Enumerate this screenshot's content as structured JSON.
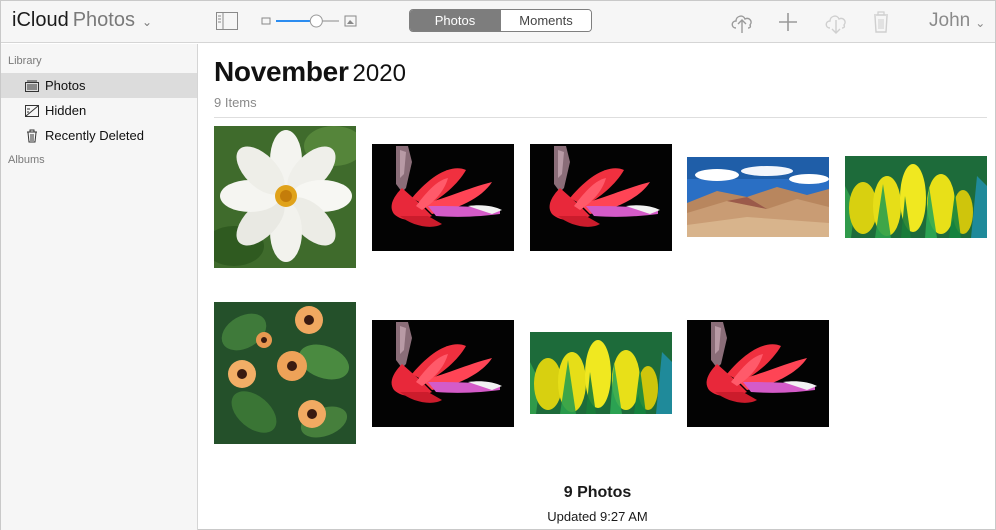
{
  "app": {
    "title_brand": "iCloud",
    "title_app": "Photos"
  },
  "toolbar": {
    "tabs": [
      {
        "label": "Photos",
        "active": true
      },
      {
        "label": "Moments",
        "active": false
      }
    ],
    "user": "John",
    "zoom_level": 0.64
  },
  "sidebar": {
    "library_label": "Library",
    "items": [
      {
        "label": "Photos",
        "icon": "photos-icon",
        "selected": true
      },
      {
        "label": "Hidden",
        "icon": "hidden-icon",
        "selected": false
      },
      {
        "label": "Recently Deleted",
        "icon": "trash-icon",
        "selected": false
      }
    ],
    "albums_label": "Albums"
  },
  "main": {
    "month": "November",
    "year": "2020",
    "item_count": "9 Items",
    "photos": [
      "white-cosmos-flower",
      "red-cactus-flower",
      "red-cactus-flower",
      "rainbow-mountains-landscape",
      "yellow-tulips",
      "orange-black-eyed-susan-vine",
      "red-cactus-flower",
      "yellow-tulips",
      "red-cactus-flower"
    ],
    "footer_title": "9 Photos",
    "footer_updated": "Updated 9:27 AM"
  },
  "colors": {
    "accent_gray": "#7d7d7d",
    "sidebar_bg": "#f6f6f6",
    "selected_bg": "#dcdcdc"
  }
}
